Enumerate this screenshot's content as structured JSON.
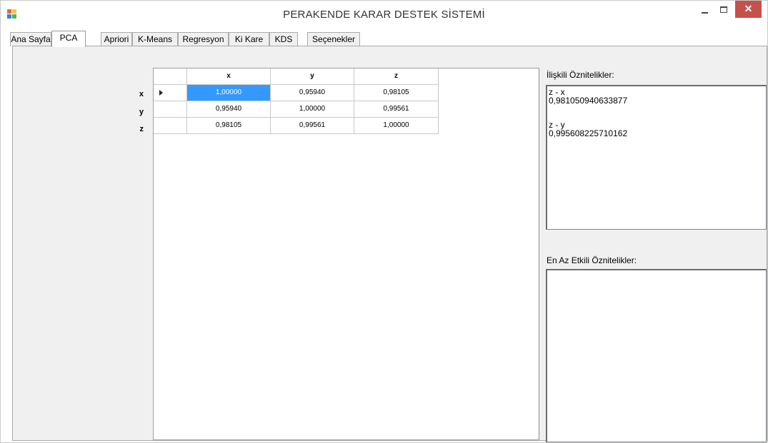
{
  "window": {
    "title": "PERAKENDE KARAR DESTEK SİSTEMİ",
    "close_glyph": "✕"
  },
  "tabs": [
    {
      "label": "Ana Sayfa"
    },
    {
      "label": "PCA"
    },
    {
      "label": "Apriori"
    },
    {
      "label": "K-Means"
    },
    {
      "label": "Regresyon"
    },
    {
      "label": "Ki Kare"
    },
    {
      "label": "KDS"
    },
    {
      "label": "Seçenekler"
    }
  ],
  "active_tab": "PCA",
  "grid": {
    "columns": [
      "x",
      "y",
      "z"
    ],
    "row_labels": [
      "x",
      "y",
      "z"
    ],
    "rows": [
      [
        "1,00000",
        "0,95940",
        "0,98105"
      ],
      [
        "0,95940",
        "1,00000",
        "0,99561"
      ],
      [
        "0,98105",
        "0,99561",
        "1,00000"
      ]
    ],
    "selected_cell": "x-x"
  },
  "related": {
    "label": "İlişkili Öznitelikler:",
    "items": [
      {
        "pair": "z - x",
        "value": "0,981050940633877"
      },
      {
        "pair": "z - y",
        "value": "0,995608225710162"
      }
    ]
  },
  "least": {
    "label": "En Az Etkili Öznitelikler:",
    "items": []
  },
  "colors": {
    "selection": "#3399ff",
    "close_button": "#c7504b",
    "panel_bg": "#f0f0f0"
  }
}
